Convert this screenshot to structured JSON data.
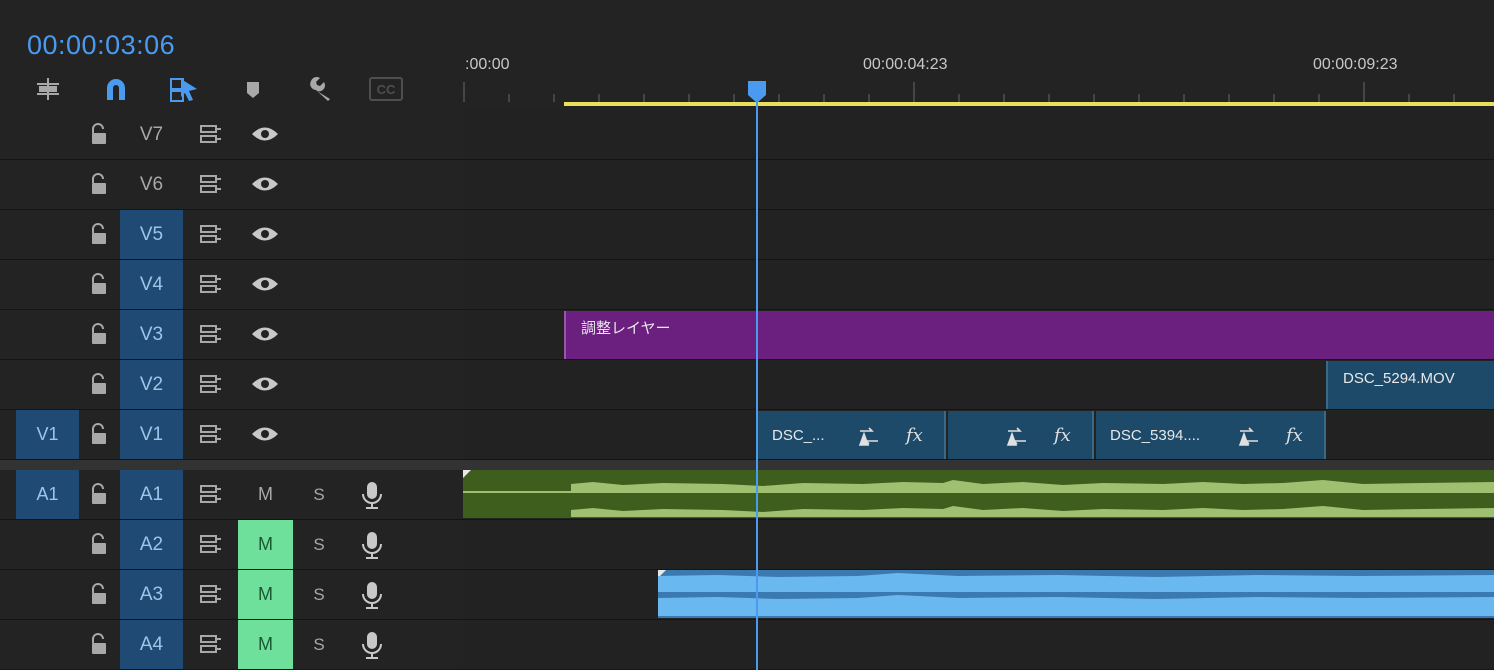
{
  "timecode": "00:00:03:06",
  "tools": [
    {
      "icon": "insert-edit-icon"
    },
    {
      "icon": "snap-magnet-icon"
    },
    {
      "icon": "linked-selection-icon"
    },
    {
      "icon": "add-marker-icon"
    },
    {
      "icon": "settings-wrench-icon"
    },
    {
      "icon": "captions-cc-icon",
      "label": "CC"
    }
  ],
  "ruler": {
    "labels": [
      ":00:00",
      "00:00:04:23",
      "00:00:09:23"
    ]
  },
  "playhead_time": "00:00:03:06",
  "video_tracks": [
    {
      "label": "V7",
      "targeted": false,
      "source": ""
    },
    {
      "label": "V6",
      "targeted": false,
      "source": ""
    },
    {
      "label": "V5",
      "targeted": true,
      "source": ""
    },
    {
      "label": "V4",
      "targeted": true,
      "source": ""
    },
    {
      "label": "V3",
      "targeted": true,
      "source": ""
    },
    {
      "label": "V2",
      "targeted": true,
      "source": ""
    },
    {
      "label": "V1",
      "targeted": true,
      "source": "V1"
    }
  ],
  "audio_tracks": [
    {
      "label": "A1",
      "source": "A1",
      "mute": "M",
      "mute_on": false,
      "solo": "S"
    },
    {
      "label": "A2",
      "source": "",
      "mute": "M",
      "mute_on": true,
      "solo": "S"
    },
    {
      "label": "A3",
      "source": "",
      "mute": "M",
      "mute_on": true,
      "solo": "S"
    },
    {
      "label": "A4",
      "source": "",
      "mute": "M",
      "mute_on": true,
      "solo": "S"
    }
  ],
  "clips": {
    "adjustment_layer": {
      "name": "調整レイヤー",
      "color": "#6b2080"
    },
    "v2_clip": {
      "name": "DSC_5294.MOV",
      "color": "#1e4a6a"
    },
    "v1_clip_1": {
      "name": "DSC_...",
      "color": "#1e4a6a"
    },
    "v1_clip_2": {
      "name": "",
      "color": "#1e4a6a"
    },
    "v1_clip_3": {
      "name": "DSC_5394....",
      "color": "#1e4a6a"
    },
    "fx_label": "fx"
  },
  "colors": {
    "accent": "#4a9bf0",
    "target_on": "#1e4a74",
    "mute_on": "#6fe09c",
    "audio_a1": "#3d5e1c",
    "audio_a3": "#6ab8f0",
    "work_area": "#e8e05a"
  }
}
